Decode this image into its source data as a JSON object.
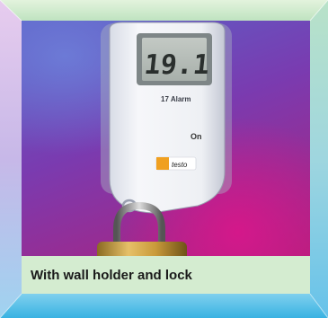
{
  "caption": "With wall holder and lock",
  "device": {
    "display_reading": "19.1",
    "model_label": "17 Alarm",
    "button_label": "On",
    "brand_label": "testo"
  },
  "colors": {
    "frame_green": "#d6ecd2",
    "frame_blue": "#6ec6e8",
    "frame_pink": "#e6a3d6",
    "caption_bg": "#d4ecd0",
    "photo_purple": "#7a3bb0",
    "photo_magenta": "#d4188a"
  }
}
